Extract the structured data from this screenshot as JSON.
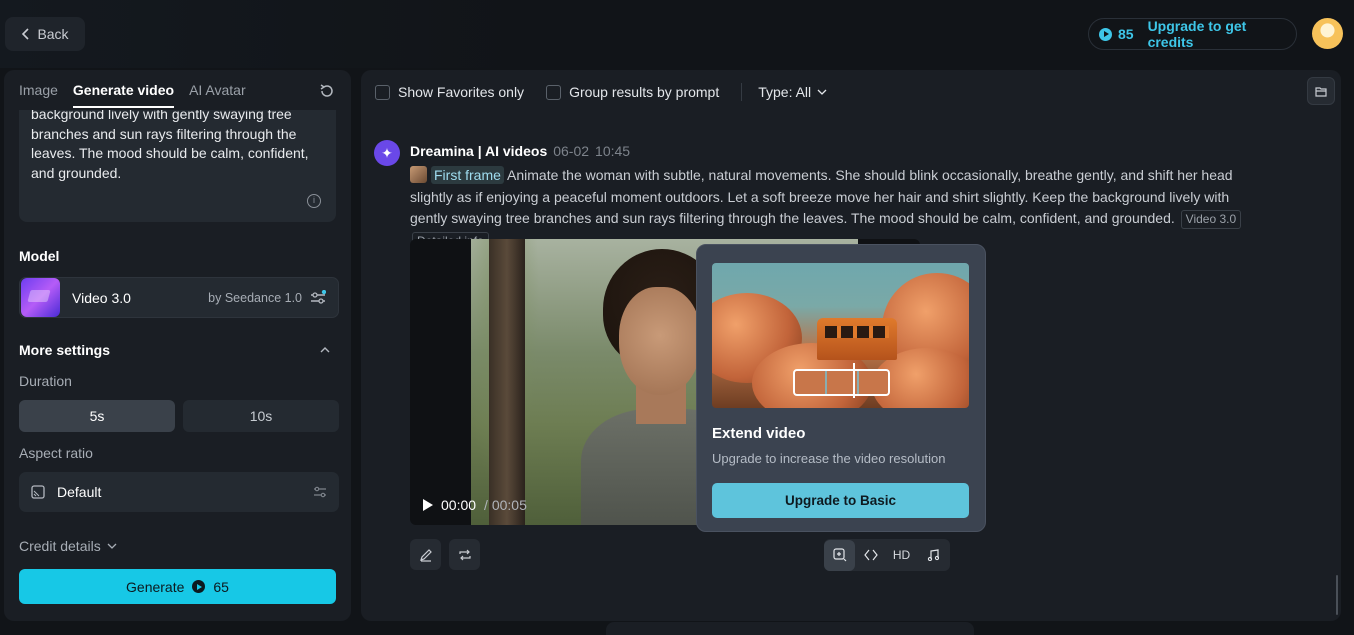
{
  "header": {
    "back_label": "Back",
    "credits": "85",
    "upgrade_label": "Upgrade to get credits"
  },
  "left_panel": {
    "tabs": [
      {
        "label": "Image"
      },
      {
        "label": "Generate video"
      },
      {
        "label": "AI Avatar"
      }
    ],
    "prompt_text": "background lively with gently swaying tree branches and sun rays filtering through the leaves. The mood should be calm, confident, and grounded.",
    "model_section_label": "Model",
    "model_name": "Video 3.0",
    "model_by": "by Seedance 1.0",
    "more_settings_label": "More settings",
    "duration_label": "Duration",
    "duration_options": [
      "5s",
      "10s"
    ],
    "aspect_label": "Aspect ratio",
    "aspect_value": "Default",
    "credit_details_label": "Credit details",
    "generate_label": "Generate",
    "generate_cost": "65"
  },
  "main_panel": {
    "filter_favorites": "Show Favorites only",
    "filter_group": "Group results by prompt",
    "type_filter": "Type: All",
    "result": {
      "author": "Dreamina | AI videos",
      "date": "06-02",
      "time": "10:45",
      "first_frame_label": "First frame",
      "prompt": "Animate the woman with subtle, natural movements. She should blink occasionally, breathe gently, and shift her head slightly as if enjoying a peaceful moment outdoors. Let a soft breeze move her hair and shirt slightly. Keep the background lively with gently swaying tree branches and sun rays filtering through the leaves. The mood should be calm, confident, and grounded.",
      "tag_model": "Video 3.0",
      "tag_details": "Detailed info",
      "video_time_current": "00:00",
      "video_time_total": "/ 00:05"
    },
    "popover": {
      "title": "Extend video",
      "subtitle": "Upgrade to increase the video resolution",
      "button": "Upgrade to Basic"
    },
    "tools": {
      "hd_label": "HD"
    }
  },
  "colors": {
    "accent": "#17c8e6",
    "background": "#111418",
    "panel": "#1a1e24",
    "popover": "#3b4350"
  }
}
